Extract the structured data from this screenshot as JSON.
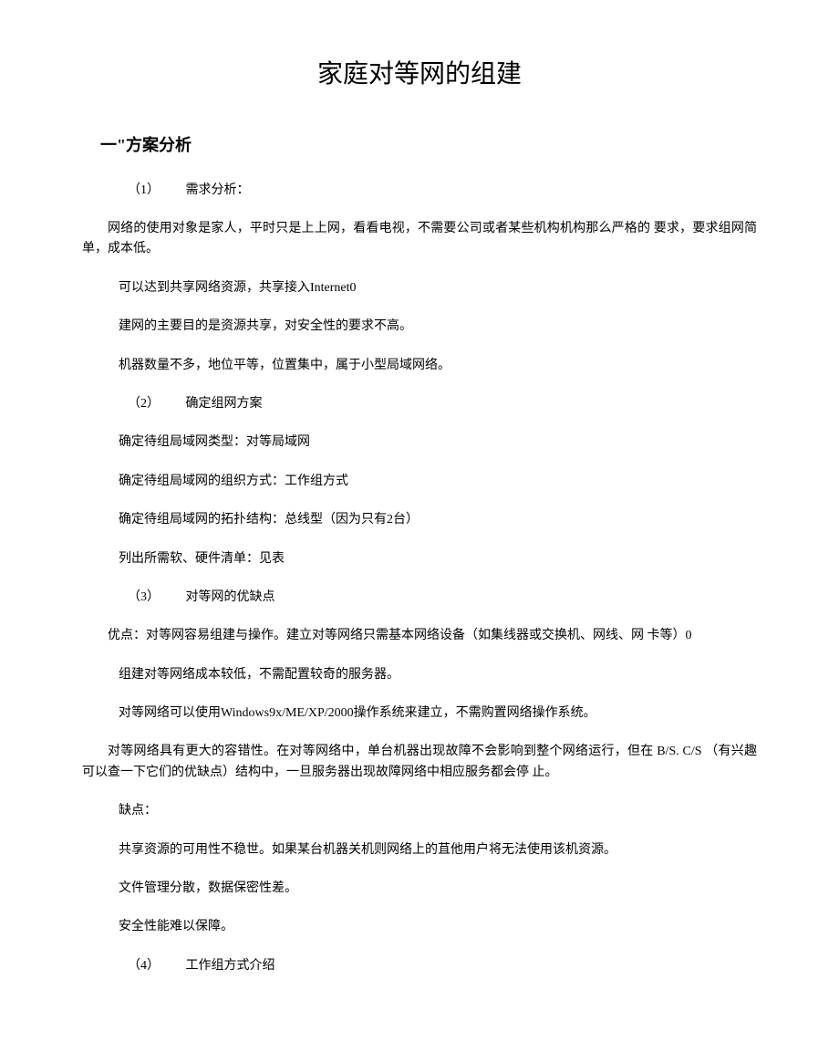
{
  "title": "家庭对等网的组建",
  "section1": {
    "heading": "一\"方案分析",
    "item1": {
      "num": "（1）",
      "label": "需求分析："
    },
    "p1": "网络的使用对象是家人，平时只是上上网，看看电视，不需要公司或者某些机构机构那么严格的 要求，要求组网简单，成本低。",
    "p2": "可以达到共享网络资源，共享接入Internet0",
    "p3": "建网的主要目的是资源共享，对安全性的要求不高。",
    "p4": "机器数量不多，地位平等，位置集中，属于小型局域网络。",
    "item2": {
      "num": "（2）",
      "label": "确定组网方案"
    },
    "p5": "确定待组局域网类型：对等局域网",
    "p6": "确定待组局域网的组织方式：工作组方式",
    "p7": "确定待组局域网的拓扑结构：总线型（因为只有2台）",
    "p8": "列出所需软、硬件清单：见表",
    "item3": {
      "num": "（3）",
      "label": "对等网的优缺点"
    },
    "p9": "优点：对等网容易组建与操作。建立对等网络只需基本网络设备（如集线器或交换机、网线、网 卡等）0",
    "p10": "组建对等网络成本较低，不需配置较奇的服务器。",
    "p11": "对等网络可以使用Windows9x/ME/XP/2000操作系统来建立，不需购置网络操作系统。",
    "p12": "对等网络具有更大的容错性。在对等网络中，单台机器出现故障不会影响到整个网络运行，但在 B/S. C/S （有兴趣可以查一下它们的优缺点）结构中，一旦服务器出现故障网络中相应服务都会停 止。",
    "p13": "缺点：",
    "p14": "共享资源的可用性不稳世。如果某台机器关机则网络上的苴他用户将无法使用该机资源。",
    "p15": "文件管理分散，数据保密性差。",
    "p16": "安全性能难以保障。",
    "item4": {
      "num": "（4）",
      "label": "工作组方式介绍"
    }
  }
}
